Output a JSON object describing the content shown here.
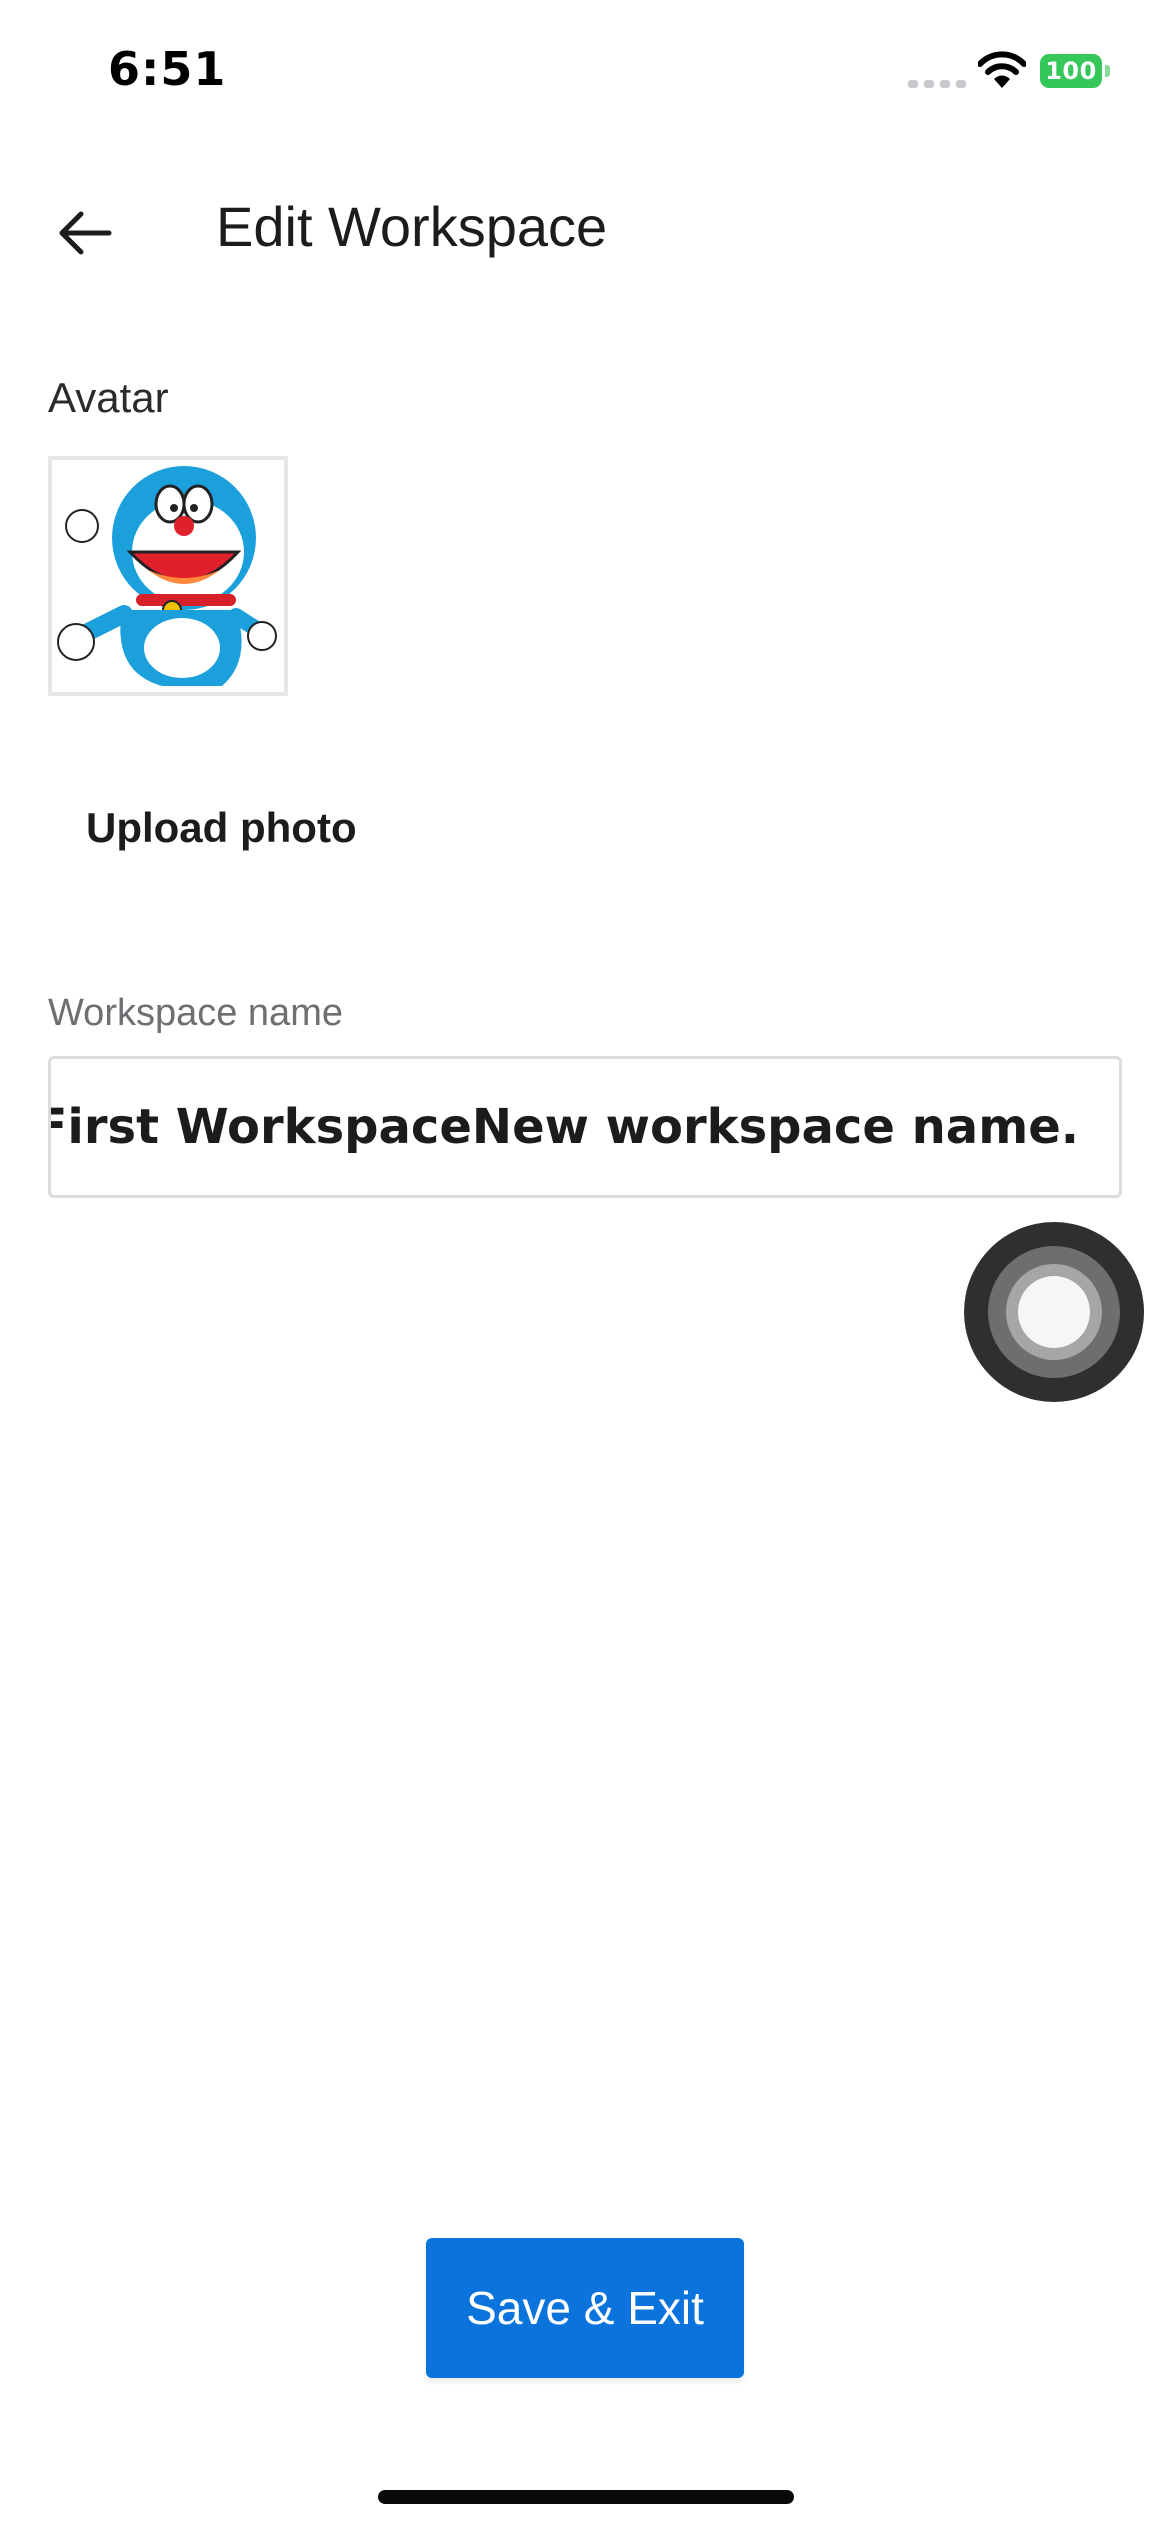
{
  "status_bar": {
    "time": "6:51",
    "battery": "100",
    "icons": [
      "signal-icon",
      "wifi-icon",
      "battery-icon"
    ]
  },
  "header": {
    "back_icon": "arrow-left-icon",
    "title": "Edit Workspace"
  },
  "avatar": {
    "label": "Avatar",
    "upload_label": "Upload photo"
  },
  "workspace_name": {
    "label": "Workspace name",
    "value": "My First WorkspaceNew workspace name."
  },
  "actions": {
    "save_label": "Save & Exit"
  },
  "colors": {
    "primary": "#0a74dc",
    "battery": "#35c759",
    "text": "#1c1c1e",
    "muted": "#6e6e73",
    "border": "#dcdcdc"
  }
}
